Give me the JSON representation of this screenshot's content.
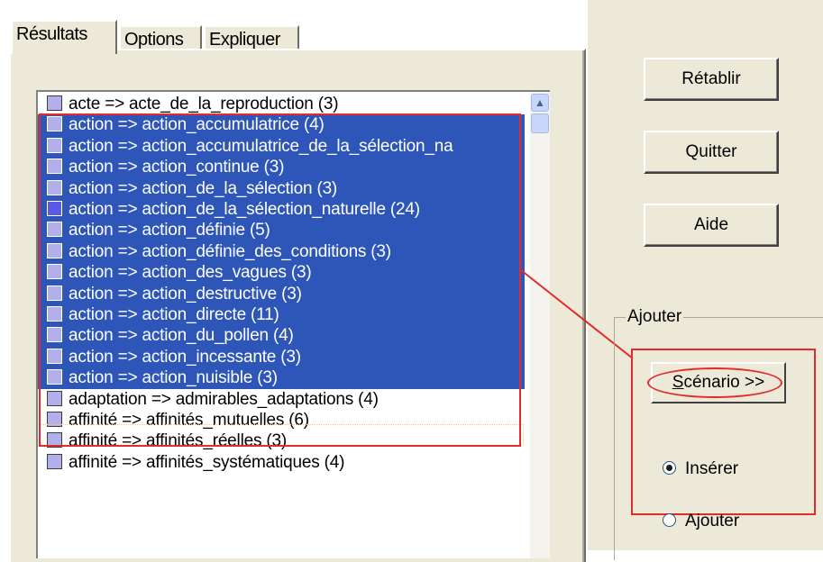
{
  "tabs": [
    {
      "label": "Résultats",
      "active": true
    },
    {
      "label": "Options",
      "active": false
    },
    {
      "label": "Expliquer",
      "active": false
    }
  ],
  "list": {
    "rows": [
      {
        "text": "acte => acte_de_la_reproduction (3)",
        "selected": false,
        "icon": "box-light"
      },
      {
        "text": "action => action_accumulatrice (4)",
        "selected": true,
        "icon": "box-light"
      },
      {
        "text": "action => action_accumulatrice_de_la_sélection_na",
        "selected": true,
        "icon": "box-light"
      },
      {
        "text": "action => action_continue (3)",
        "selected": true,
        "icon": "box-light"
      },
      {
        "text": "action => action_de_la_sélection (3)",
        "selected": true,
        "icon": "box-light"
      },
      {
        "text": "action => action_de_la_sélection_naturelle (24)",
        "selected": true,
        "icon": "box-dark"
      },
      {
        "text": "action => action_définie (5)",
        "selected": true,
        "icon": "box-light"
      },
      {
        "text": "action => action_définie_des_conditions (3)",
        "selected": true,
        "icon": "box-light"
      },
      {
        "text": "action => action_des_vagues (3)",
        "selected": true,
        "icon": "box-light"
      },
      {
        "text": "action => action_destructive (3)",
        "selected": true,
        "icon": "box-light"
      },
      {
        "text": "action => action_directe (11)",
        "selected": true,
        "icon": "box-light"
      },
      {
        "text": "action => action_du_pollen (4)",
        "selected": true,
        "icon": "box-light"
      },
      {
        "text": "action => action_incessante (3)",
        "selected": true,
        "icon": "box-light"
      },
      {
        "text": "action => action_nuisible (3)",
        "selected": true,
        "icon": "box-light"
      },
      {
        "text": "adaptation => admirables_adaptations (4)",
        "selected": false,
        "icon": "box-light"
      },
      {
        "text": "affinité => affinités_mutuelles (6)",
        "selected": false,
        "icon": "box-light"
      },
      {
        "text": "affinité => affinités_réelles (3)",
        "selected": false,
        "icon": "box-light"
      },
      {
        "text": "affinité => affinités_systématiques (4)",
        "selected": false,
        "icon": "box-light"
      }
    ]
  },
  "buttons": {
    "retablir": "Rétablir",
    "quitter": "Quitter",
    "aide": "Aide"
  },
  "ajouter_group": {
    "legend": "Ajouter",
    "scenario_button": "Scénario >>",
    "scenario_underline": "S",
    "scenario_rest": "cénario >>",
    "radio_inserer": "Insérer",
    "radio_ajouter": "Ajouter",
    "selected_option": "Insérer"
  },
  "colors": {
    "selection": "#2e56b8",
    "annotation_red": "#e22b2b",
    "dialog_bg": "#ece9d8"
  }
}
